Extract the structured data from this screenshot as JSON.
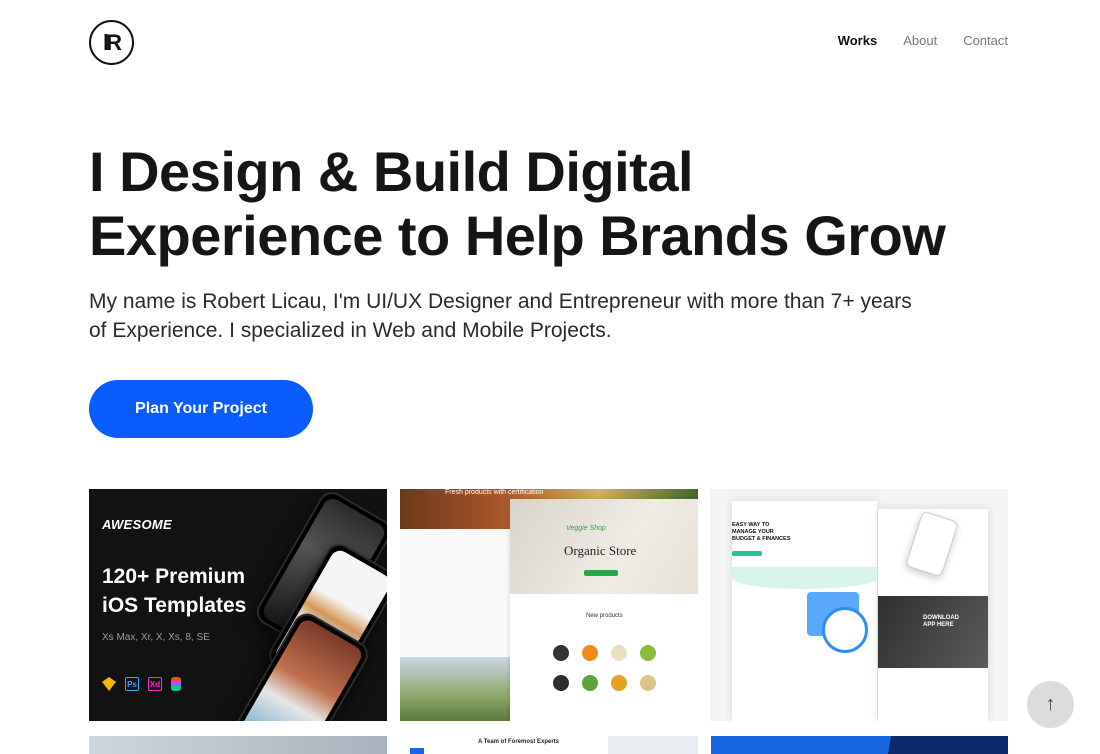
{
  "header": {
    "logo_text_1": "l",
    "logo_text_2": "R",
    "nav": [
      {
        "label": "Works",
        "active": true
      },
      {
        "label": "About",
        "active": false
      },
      {
        "label": "Contact",
        "active": false
      }
    ]
  },
  "hero": {
    "title_line1": "I Design & Build Digital",
    "title_line2": "Experience to Help Brands Grow",
    "subtitle": "My name is Robert Licau, I'm UI/UX Designer and Entrepreneur with more than 7+ years of Experience. I specialized in Web and Mobile Projects.",
    "cta_label": "Plan Your Project"
  },
  "works": [
    {
      "brand": "AWESOME",
      "title_line1": "120+ Premium",
      "title_line2": "iOS Templates",
      "subtitle": "Xs Max, Xr, X, Xs, 8, SE",
      "tools": [
        "sketch-icon",
        "photoshop-icon",
        "xd-icon",
        "figma-icon"
      ],
      "tool_labels": [
        "",
        "Ps",
        "Xd",
        ""
      ]
    },
    {
      "top_line": "Fresh products with certification",
      "brand_script": "Veggie Shop",
      "title": "Organic Store",
      "section": "New products"
    },
    {
      "title_line1": "EASY WAY TO",
      "title_line2": "MANAGE YOUR",
      "title_line3": "BUDGET & FINANCES",
      "download_line1": "DOWNLOAD",
      "download_line2": "APP HERE"
    }
  ],
  "row2": {
    "card2_heading": "A Team of Foremost Experts"
  },
  "scroll_top": {
    "icon": "arrow-up-icon",
    "glyph": "↑"
  },
  "colors": {
    "accent": "#0a5cff",
    "text": "#151515",
    "muted": "#777777",
    "green": "#2aa744",
    "teal": "#22c39a"
  }
}
